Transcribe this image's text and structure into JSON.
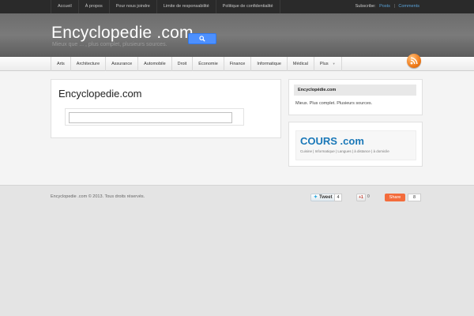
{
  "topbar": {
    "links": [
      "Accueil",
      "À propos",
      "Pour nous joindre",
      "Limite de responsabilité",
      "Politique de confidentialité"
    ],
    "subscribe_label": "Subscribe:",
    "posts": "Posts",
    "separator": "|",
    "comments": "Comments"
  },
  "header": {
    "site_title": "Encyclopedie .com",
    "tagline": "Mieux que ... , plus complet, plusieurs sources."
  },
  "nav": {
    "items": [
      "Arts",
      "Architecture",
      "Assurance",
      "Automobile",
      "Droit",
      "Économie",
      "Finance",
      "Informatique",
      "Médical"
    ],
    "more": "Plus",
    "more_arrow": "▼",
    "rss_icon": "rss-feed-icon"
  },
  "main": {
    "title": "Encyclopedie.com",
    "search_value": "",
    "search_icon": "search-icon"
  },
  "sidebar": {
    "widget_title": "Encyclopédie.com",
    "widget_text": "Mieux. Plus complet. Plusieurs sources.",
    "banner_logo": "COURS .com",
    "banner_sub": "Cuisine | Informatique | Langues | à distance | à domicile"
  },
  "footer": {
    "copyright": "Encyclopedie .com © 2013. Tous droits réservés.",
    "tweet_label": "Tweet",
    "tweet_count": "4",
    "gplus_label": "+1",
    "gplus_count": "0",
    "share_label": "Share",
    "share_count": "8"
  },
  "colors": {
    "accent": "#5aa2d8",
    "search_button": "#4d90fe",
    "share_button": "#f36c3c",
    "rss": "#f07b1a",
    "cours_logo": "#1a78b8"
  }
}
